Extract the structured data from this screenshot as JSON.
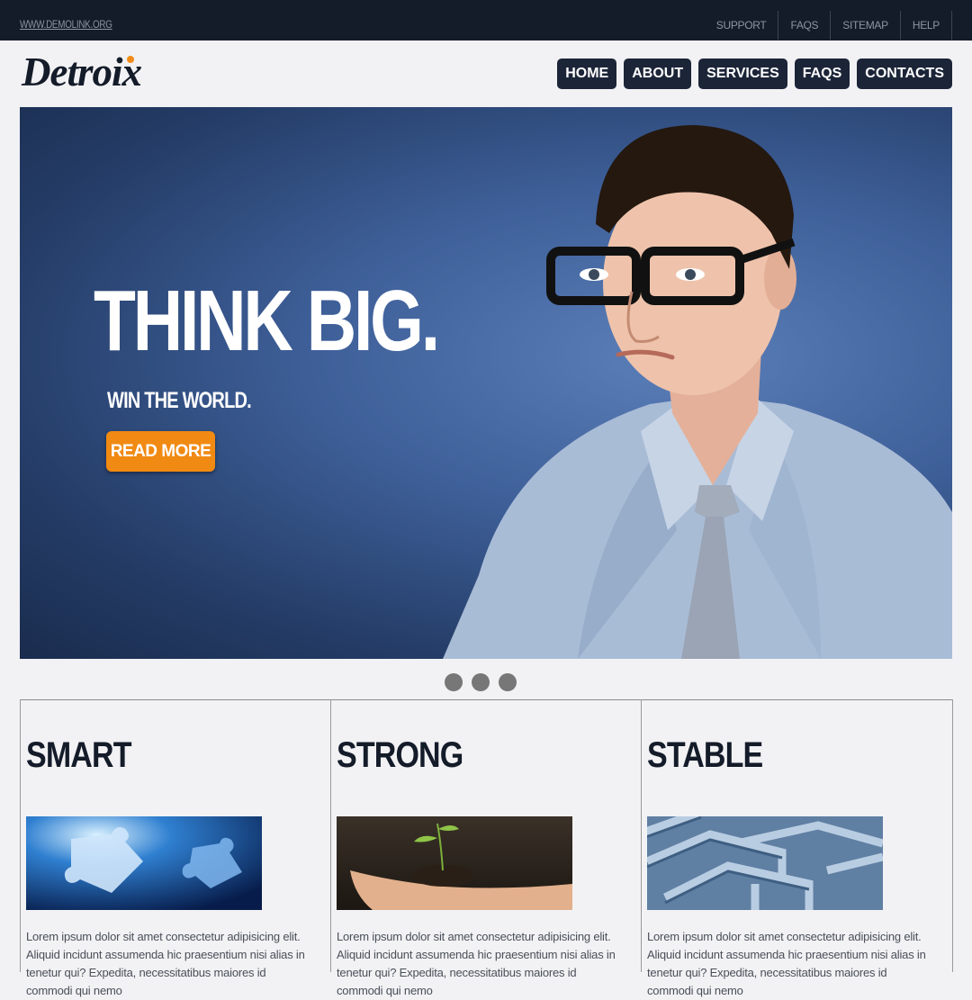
{
  "topbar": {
    "site_link": "WWW.DEMOLINK.ORG",
    "links": [
      "SUPPORT",
      "FAQS",
      "SITEMAP",
      "HELP"
    ]
  },
  "logo": {
    "text": "Detroix"
  },
  "nav": {
    "items": [
      "HOME",
      "ABOUT",
      "SERVICES",
      "FAQS",
      "CONTACTS"
    ]
  },
  "hero": {
    "title": "THINK BIG.",
    "subtitle": "WIN THE WORLD.",
    "button": "READ MORE"
  },
  "slider": {
    "dot_count": 3
  },
  "features": [
    {
      "title": "SMART",
      "image": "puzzle-pieces",
      "text": "Lorem ipsum dolor sit amet consectetur adipisicing elit. Aliquid incidunt assumenda hic praesentium nisi alias in tenetur qui? Expedita, necessitatibus maiores id commodi qui nemo"
    },
    {
      "title": "STRONG",
      "image": "seedling-in-hand",
      "text": "Lorem ipsum dolor sit amet consectetur adipisicing elit. Aliquid incidunt assumenda hic praesentium nisi alias in tenetur qui? Expedita, necessitatibus maiores id commodi qui nemo"
    },
    {
      "title": "STABLE",
      "image": "maze",
      "text": "Lorem ipsum dolor sit amet consectetur adipisicing elit. Aliquid incidunt assumenda hic praesentium nisi alias in tenetur qui? Expedita, necessitatibus maiores id commodi qui nemo"
    }
  ],
  "colors": {
    "topbar": "#141b29",
    "nav_button": "#1c2538",
    "accent": "#f28c18",
    "page": "#f2f2f4"
  }
}
